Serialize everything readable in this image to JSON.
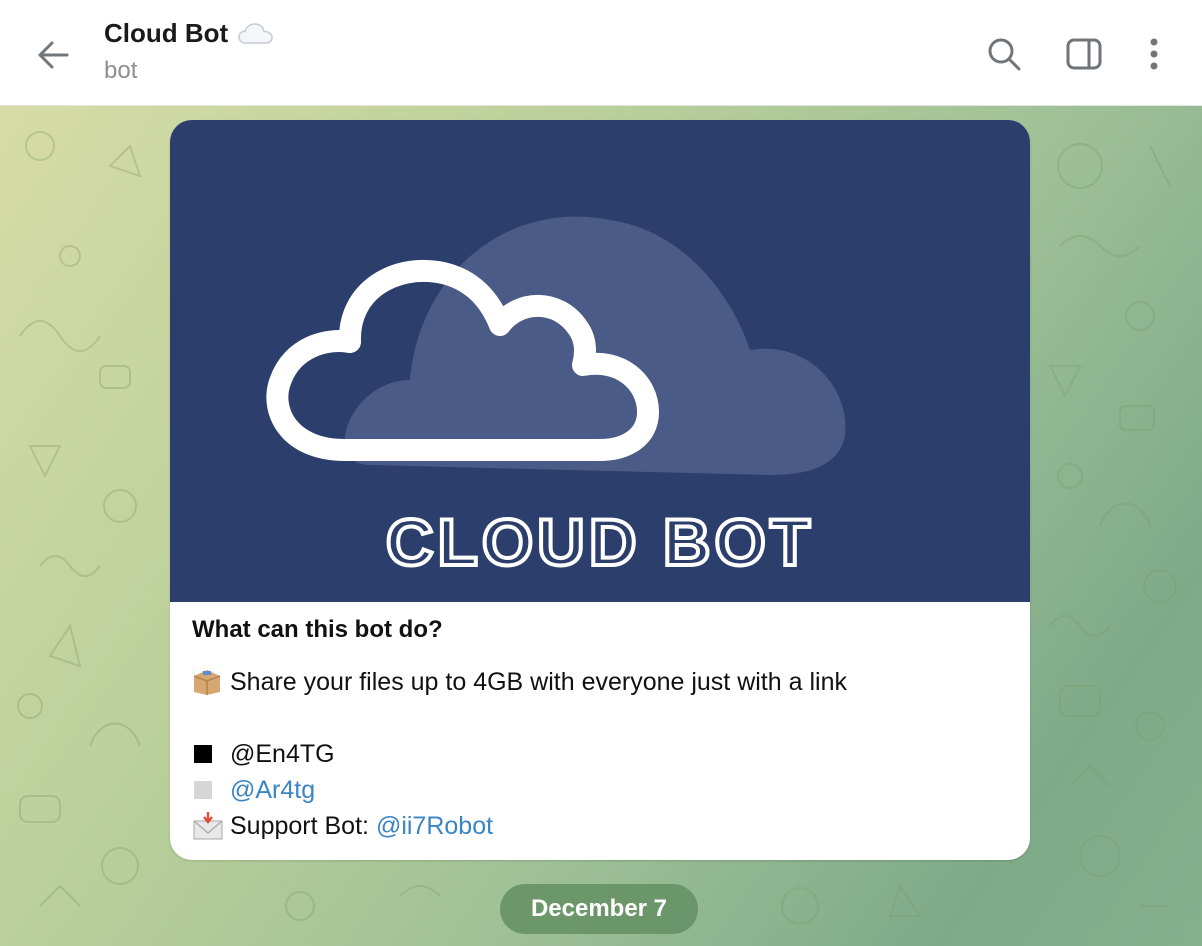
{
  "header": {
    "title": "Cloud Bot",
    "subtitle": "bot",
    "title_emoji_icon": "cloud-icon"
  },
  "cover": {
    "logo_text": "CLOUD BOT",
    "background_color": "#2c3e6b"
  },
  "bot_info": {
    "heading": "What can this bot do?",
    "description": "Share your files up to 4GB with everyone just with a link",
    "lines": [
      {
        "icon": "black-square-icon",
        "prefix": "",
        "text": "@En4TG",
        "is_link": false
      },
      {
        "icon": "gray-square-icon",
        "prefix": "",
        "text": "@Ar4tg",
        "is_link": true
      },
      {
        "icon": "envelope-arrow-icon",
        "prefix": "Support Bot: ",
        "text": "@ii7Robot",
        "is_link": true
      }
    ]
  },
  "date_separator": "December 7",
  "colors": {
    "link": "#3a85c3",
    "accent_bg": "#9fc197"
  }
}
